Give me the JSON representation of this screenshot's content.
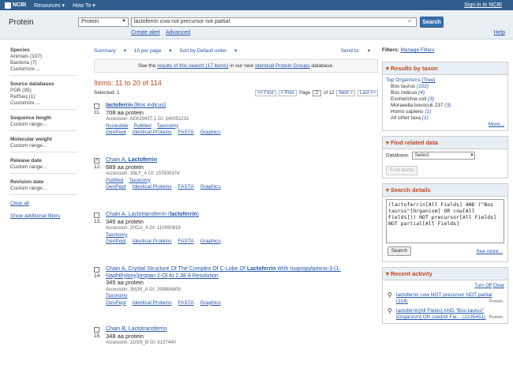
{
  "topbar": {
    "logo": "NCBI",
    "menu": [
      "Resources",
      "How To"
    ],
    "signin": "Sign in to NCBI"
  },
  "search": {
    "db_title": "Protein",
    "db_value": "Protein",
    "term": "lactoferrin cow not precursor not partial",
    "button": "Search",
    "create_alert": "Create alert",
    "advanced": "Advanced",
    "help": "Help"
  },
  "sidebar": [
    {
      "title": "Species",
      "items": [
        "Animals (107)",
        "Bacteria (7)",
        "Customize ..."
      ]
    },
    {
      "title": "Source databases",
      "items": [
        "PDB (95)",
        "RefSeq (1)",
        "Customize ..."
      ]
    },
    {
      "title": "Sequence length",
      "items": [
        "Custom range..."
      ]
    },
    {
      "title": "Molecular weight",
      "items": [
        "Custom range..."
      ]
    },
    {
      "title": "Release date",
      "items": [
        "Custom range..."
      ]
    },
    {
      "title": "Revision date",
      "items": [
        "Custom range..."
      ]
    }
  ],
  "sidebar_links": {
    "clear_all": "Clear all",
    "show_additional": "Show additional filters"
  },
  "toolbar": {
    "summary": "Summary",
    "per_page": "10 per page",
    "sort": "Sort by Default order",
    "send_to": "Send to:"
  },
  "notice": {
    "pre": "See the ",
    "link1": "results of this search (17 items)",
    "mid": " in our new ",
    "link2": "Identical Protein Groups",
    "post": " database."
  },
  "items_title": "Items: 11 to 20 of 114",
  "selected": "Selected: 1",
  "pager": {
    "first": "<< First",
    "prev": "< Prev",
    "page_label": "Page",
    "page": "2",
    "of": "of 12",
    "next": "Next >",
    "last": "Last >>"
  },
  "results": [
    {
      "num": "11.",
      "checked": false,
      "title_html": "lactoferrin",
      "title_rest": " [Bos indicus]",
      "aa": "708 aa protein",
      "acc": "Accession: AEK29437.1   GI: 340051231",
      "sub": [
        "Nucleotide",
        "PubMed",
        "Taxonomy"
      ],
      "bot": [
        "GenPept",
        "Identical Proteins",
        "FASTA",
        "Graphics"
      ]
    },
    {
      "num": "12.",
      "checked": true,
      "title_pre": "Chain A, ",
      "title_html": "Lactoferrin",
      "title_rest": "",
      "aa": "689 aa protein",
      "acc": "Accession: 1BLF_A   GI: 157830374",
      "sub": [
        "PubMed",
        "Taxonomy"
      ],
      "bot": [
        "GenPept",
        "Identical Proteins",
        "FASTA",
        "Graphics"
      ]
    },
    {
      "num": "13.",
      "checked": false,
      "title_pre": "Chain A, Lactotransferrin (",
      "title_html": "lactoferrin",
      "title_rest": ")",
      "aa": "345 aa protein",
      "acc": "Accession: 2HCA_A   GI: 110590619",
      "sub": [
        "Taxonomy"
      ],
      "bot": [
        "GenPept",
        "Identical Proteins",
        "FASTA",
        "Graphics"
      ]
    },
    {
      "num": "14.",
      "checked": false,
      "title_pre": "Chain A, Crystal Structure Of The Complex Of C-Lobe Of ",
      "title_html": "Lactoferrin",
      "title_rest": " With Isopropylamino-3-(1-Naphthyloxy)propan-2-Ol At 2.38 A Resolution",
      "aa": "345 aa protein",
      "acc": "Accession: 3MJN_A   GI: 299856809",
      "sub": [
        "Taxonomy"
      ],
      "bot": [
        "GenPept",
        "Identical Proteins",
        "FASTA",
        "Graphics"
      ]
    },
    {
      "num": "15.",
      "checked": false,
      "title_pre": "Chain B, Lactotransferrin",
      "title_html": "",
      "title_rest": "",
      "aa": "348 aa protein",
      "acc": "Accession: 1DSN_B   GI: 6137440",
      "sub": [],
      "bot": []
    }
  ],
  "right": {
    "filters_label": "Filters:",
    "manage_filters": "Manage Filters",
    "taxon_title": "Results by taxon",
    "top_org": "Top Organisms",
    "tree": "[Tree]",
    "taxa": [
      {
        "name": "Bos taurus",
        "count": "(102)"
      },
      {
        "name": "Bos indicus",
        "count": "(4)"
      },
      {
        "name": "Escherichia coli",
        "count": "(3)"
      },
      {
        "name": "Moraxella bovoculi 237",
        "count": "(3)"
      },
      {
        "name": "Homo sapiens",
        "count": "(1)"
      },
      {
        "name": "All other taxa",
        "count": "(1)"
      }
    ],
    "more": "More...",
    "related_title": "Find related data",
    "database_label": "Database:",
    "database_value": "Select",
    "find_items": "Find items",
    "details_title": "Search details",
    "query": "(lactoferrin[All Fields] AND (\"Bos taurus\"[Organism] OR cow[All Fields])) NOT precursor[All Fields] NOT partial[All Fields]",
    "search_btn": "Search",
    "see_more": "See more...",
    "recent_title": "Recent activity",
    "turn_off": "Turn Off",
    "clear": "Clear",
    "recent": [
      {
        "text": "lactoferrin cow NOT precursor NOT partial (114)",
        "type": "Protein"
      },
      {
        "text": "lactoferrin[All Fields] AND \"Bos taurus\"[Organism] OR cow[All Fie... (2235451)",
        "type": "Protein"
      }
    ]
  }
}
